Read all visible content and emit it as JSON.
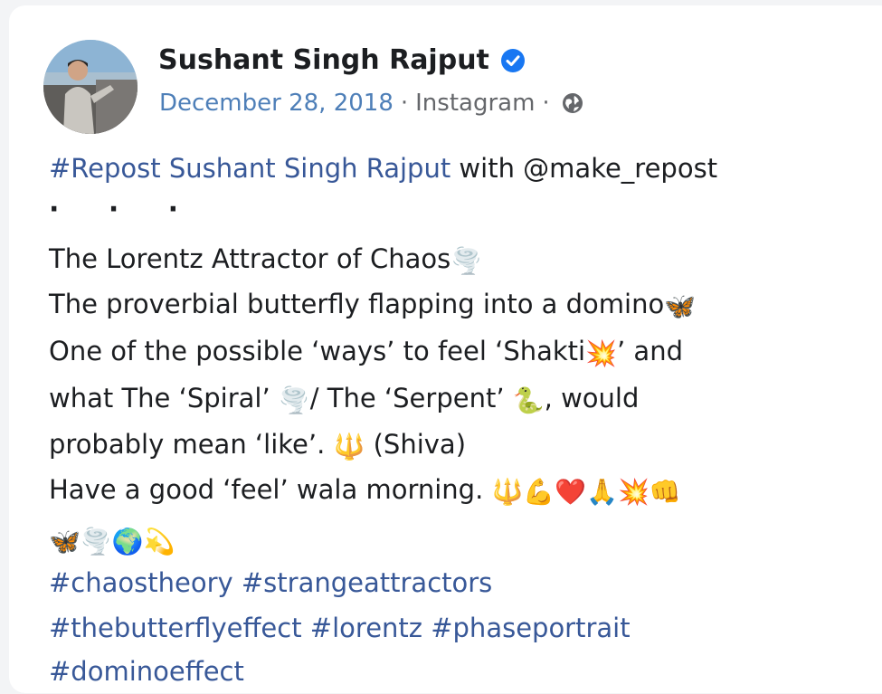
{
  "post": {
    "author_name": "Sushant Singh Rajput",
    "date": "December 28, 2018",
    "source": "Instagram",
    "separator": "·",
    "repost_tag": "#Repost Sushant Singh Rajput",
    "repost_rest": " with @make_repost",
    "dots": "· · ·",
    "lines": [
      {
        "text": "The Lorentz Attractor of Chaos",
        "emoji": "🌪️"
      },
      {
        "text": "The proverbial butterfly flapping into a domino",
        "emoji": "🦋"
      },
      {
        "text_a": "One of the possible ‘ways’ to feel ‘Shakti",
        "emoji": "💥",
        "text_b": "’ and"
      },
      {
        "text_a": "what The ‘Spiral’ ",
        "emoji_a": "🌪️",
        "text_b": "/ The ‘Serpent’ ",
        "emoji_b": "🐍",
        "text_c": ", would"
      },
      {
        "text_a": "probably mean ‘like’. ",
        "emoji": "🔱",
        "text_b": " (Shiva)"
      },
      {
        "text": "Have a good ‘feel’ wala morning. ",
        "emojis": "🔱💪❤️🙏💥👊"
      },
      {
        "emojis": "🦋🌪️🌍💫"
      }
    ],
    "hashtags": [
      "#chaostheory #strangeattractors",
      "#thebutterflyeffect #lorentz #phaseportrait",
      "#dominoeffect"
    ]
  },
  "icons": {
    "verified": "verified-badge-icon",
    "globe": "globe-icon"
  },
  "colors": {
    "link": "#385898",
    "date": "#4e7fb8",
    "verified": "#1877f2",
    "text": "#1c1e21",
    "meta": "#65676b"
  }
}
